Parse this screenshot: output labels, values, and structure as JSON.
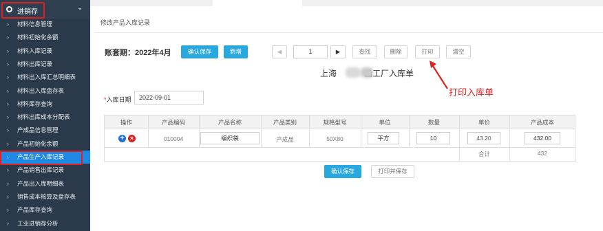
{
  "sidebar": {
    "title": "进销存",
    "items": [
      {
        "label": "材料信息管理"
      },
      {
        "label": "材料初始化余额"
      },
      {
        "label": "材料入库记录"
      },
      {
        "label": "材料出库记录"
      },
      {
        "label": "材料出入库汇总明细表"
      },
      {
        "label": "材料出入库盘存表"
      },
      {
        "label": "材料库存查询"
      },
      {
        "label": "材料出库成本分配表"
      },
      {
        "label": "产成品信息管理"
      },
      {
        "label": "产品初始化余额"
      },
      {
        "label": "产品生产入库记录",
        "active": true
      },
      {
        "label": "产品销售出库记录"
      },
      {
        "label": "产品出入库明细表"
      },
      {
        "label": "销售成本核算及盘存表"
      },
      {
        "label": "产品库存查询"
      },
      {
        "label": "工业进销存分析"
      }
    ]
  },
  "page": {
    "title": "修改产品入库记录"
  },
  "toolbar": {
    "period": "账套期：2022年4月",
    "confirm_save": "确认保存",
    "add": "新增",
    "prev": "◀",
    "page_number": "1",
    "next": "▶",
    "find": "查找",
    "delete": "删除",
    "print": "打印",
    "clear": "清空"
  },
  "document": {
    "title_left": "上海",
    "title_right": "齿工厂入库单"
  },
  "annotation": {
    "text": "打印入库单",
    "color": "#e02020"
  },
  "form": {
    "date_label": "入库日期",
    "date_value": "2022-09-01",
    "required_mark": "*"
  },
  "table": {
    "headers": [
      "操作",
      "产品编码",
      "产品名称",
      "产品类别",
      "规格型号",
      "单位",
      "数量",
      "单价",
      "产品成本"
    ],
    "row": {
      "code": "010004",
      "name": "编织袋",
      "category": "产成品",
      "spec": "50X80",
      "unit": "平方",
      "quantity": "10",
      "price": "43.20",
      "cost": "432.00"
    },
    "total_label": "合计",
    "total_value": "432"
  },
  "footer": {
    "confirm_save": "确认保存",
    "print_save": "打印并保存"
  },
  "colors": {
    "sidebar_bg": "#2b3a4a",
    "active_bg": "#1e88e5",
    "accent": "#29a8e0",
    "highlight_red": "#e02020"
  },
  "icons": {
    "add_row": "plus-circle-icon",
    "delete_row": "x-circle-icon"
  }
}
